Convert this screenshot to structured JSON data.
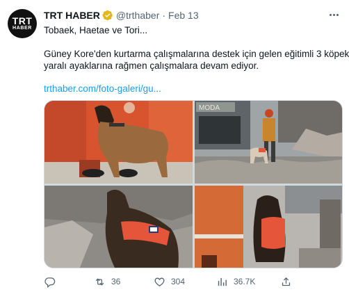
{
  "tweet": {
    "avatar": {
      "line1": "TRT",
      "line2": "HABER"
    },
    "author": {
      "name": "TRT HABER",
      "handle": "@trthaber",
      "separator": "·",
      "date": "Feb 13"
    },
    "text": {
      "line1": "Tobaek, Haetae ve Tori...",
      "line2": "Güney Kore'den kurtarma çalışmalarına destek için gelen eğitimli 3 köpek,",
      "line3": "yaralı ayaklarına rağmen çalışmalara devam ediyor."
    },
    "link": "trthaber.com/foto-galeri/gu...",
    "media": {
      "photo2_sign": "MODA"
    },
    "actions": {
      "reply": {
        "icon": "reply-icon",
        "count": ""
      },
      "retweet": {
        "icon": "retweet-icon",
        "count": "36"
      },
      "like": {
        "icon": "heart-icon",
        "count": "304"
      },
      "views": {
        "icon": "views-icon",
        "count": "36.7K"
      },
      "share": {
        "icon": "share-icon",
        "count": ""
      }
    }
  },
  "colors": {
    "text": "#0f1419",
    "secondary": "#536471",
    "link": "#1d9bf0",
    "verified_gold": "#e2b719",
    "vest_orange": "#e4553a"
  }
}
